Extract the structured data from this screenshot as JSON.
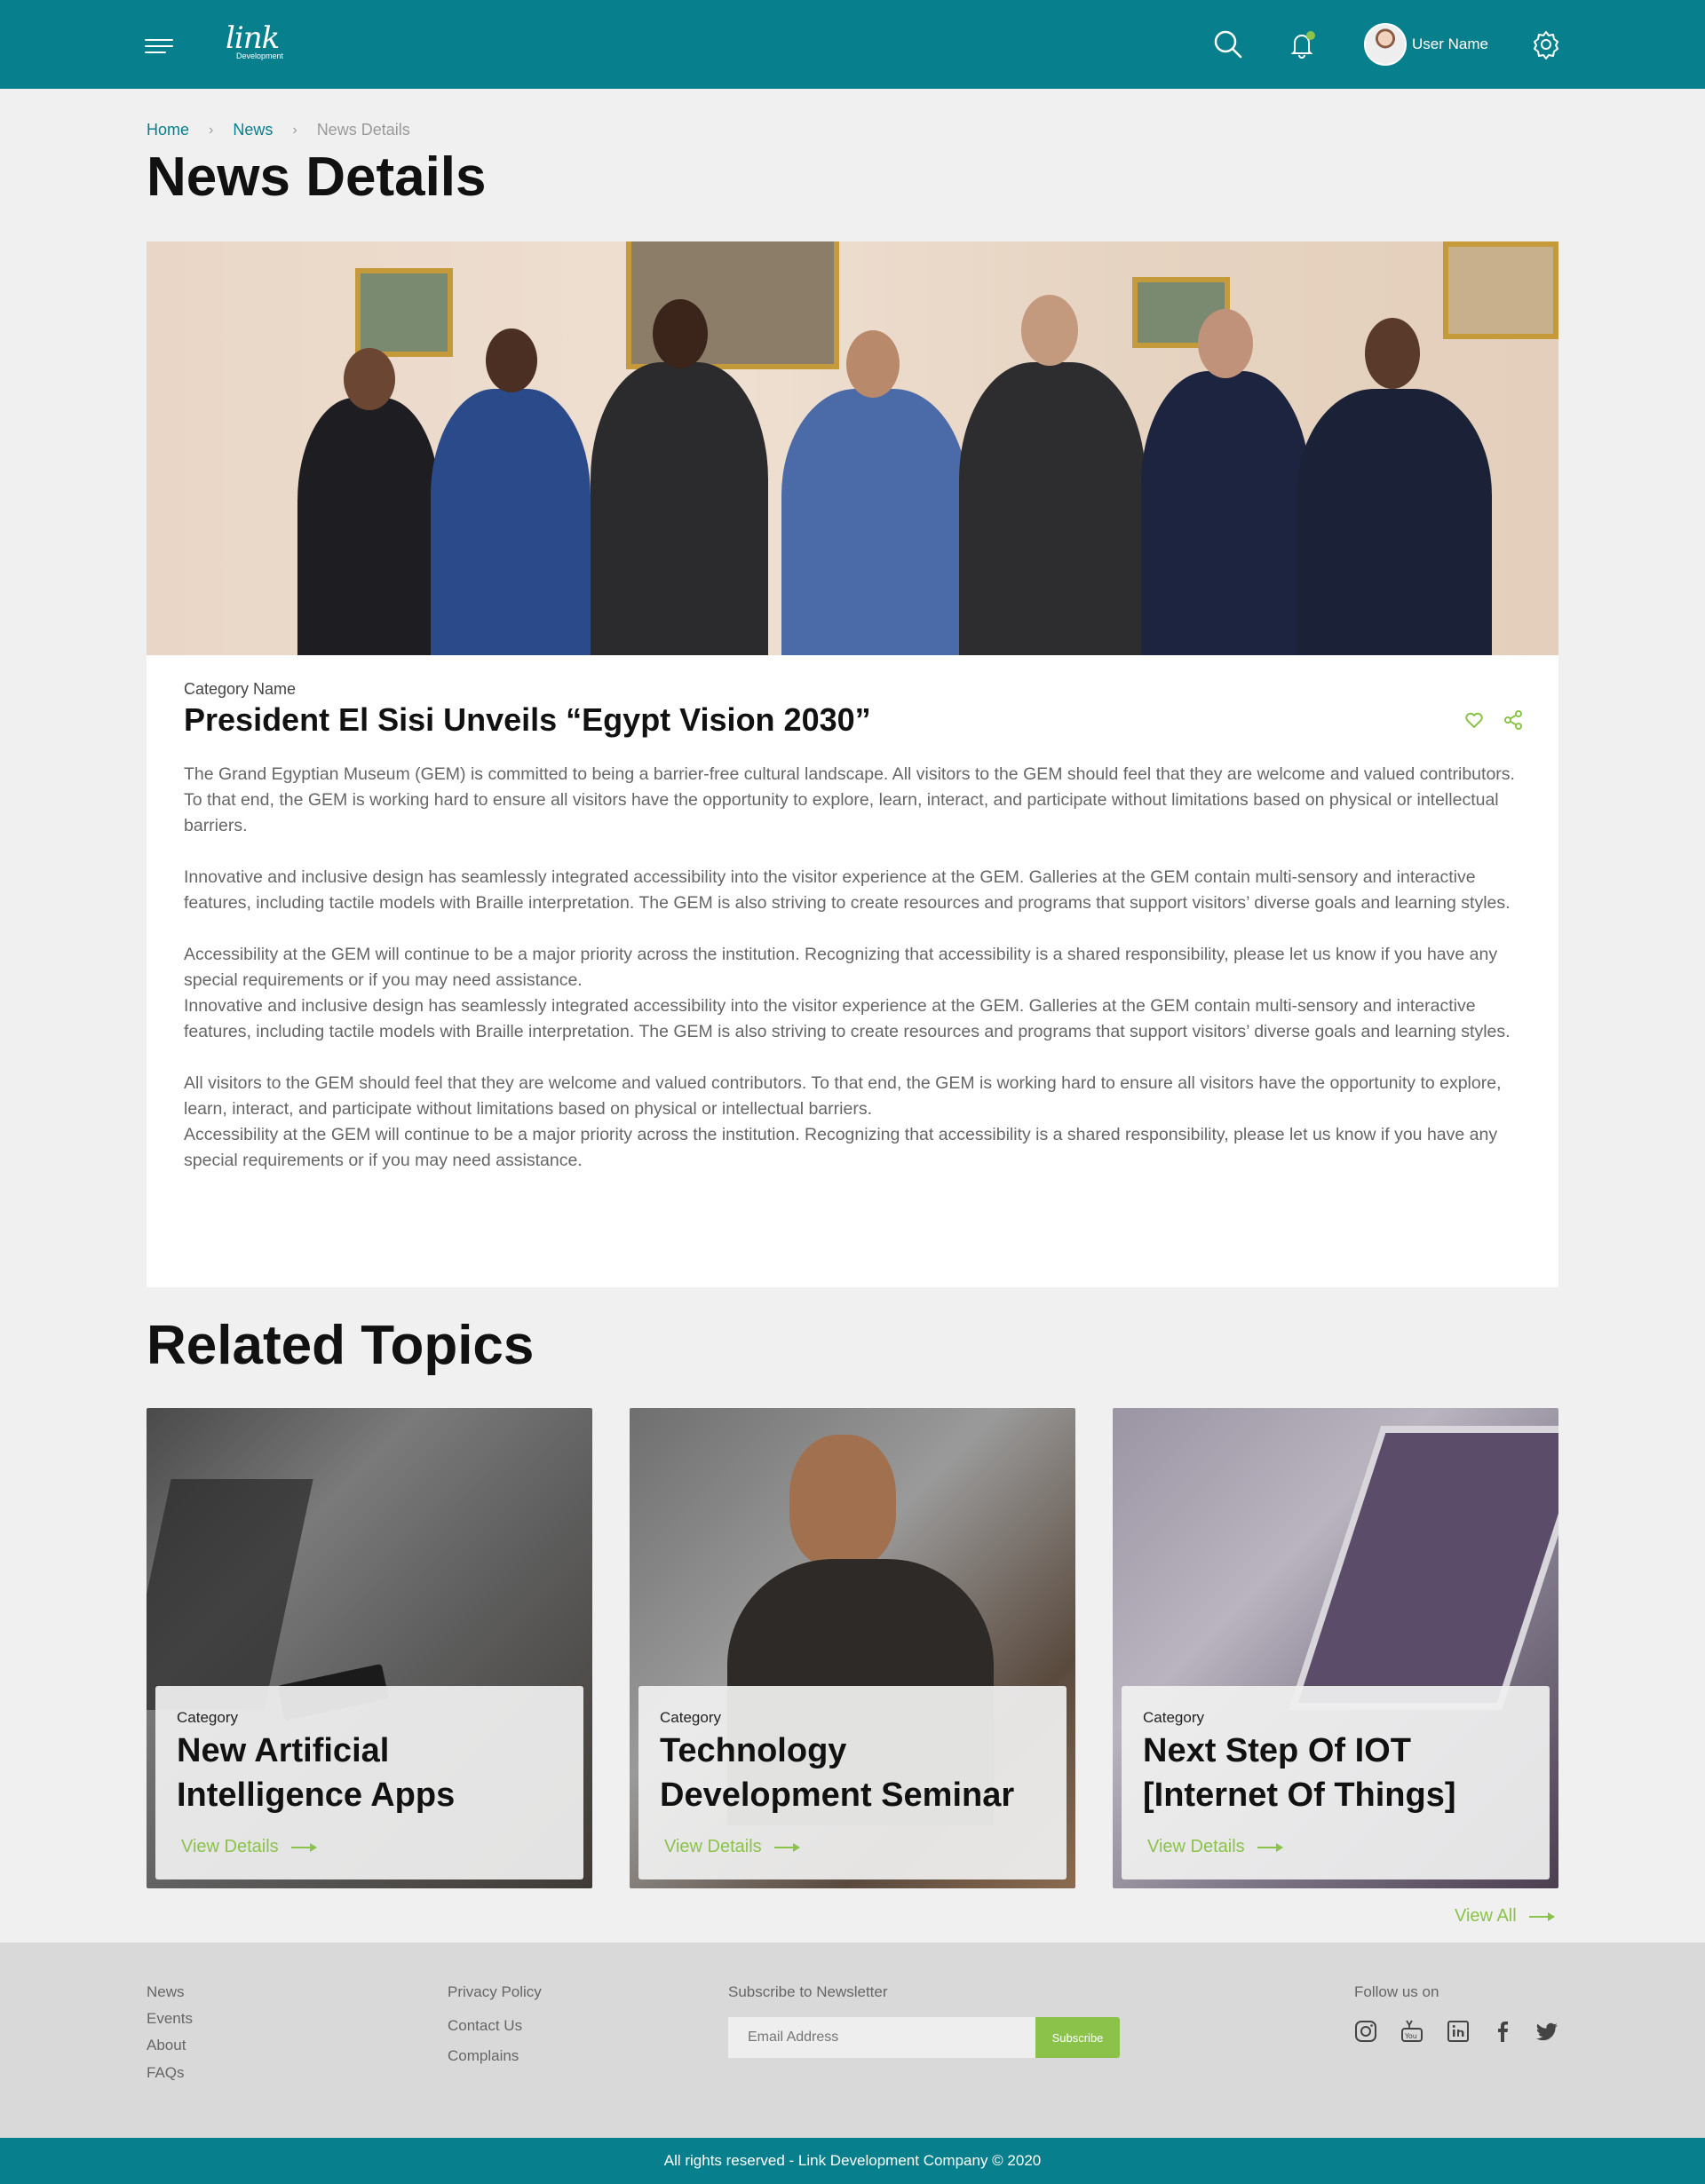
{
  "header": {
    "logo_text": "link",
    "logo_sub": "Development",
    "user_name": "User Name",
    "icons": [
      "menu-icon",
      "search-icon",
      "bell-icon",
      "settings-icon"
    ],
    "accent": "#087f8c"
  },
  "breadcrumb": {
    "items": [
      "Home",
      "News",
      "News Details"
    ],
    "separator": "›"
  },
  "page_title": "News Details",
  "article": {
    "category": "Category Name",
    "title": "President El Sisi Unveils “Egypt Vision 2030”",
    "paragraphs": [
      "The Grand Egyptian Museum (GEM) is committed to being a barrier-free cultural landscape. All visitors to the GEM should feel that they are welcome and valued contributors. To that end, the GEM is working hard to ensure all visitors have the opportunity to explore, learn, interact, and participate without limitations based on physical or intellectual barriers.",
      "Innovative and inclusive design has seamlessly integrated accessibility into the visitor experience at the GEM.  Galleries at the GEM contain multi-sensory and interactive features, including tactile models with Braille interpretation. The GEM is also striving to create resources and programs that support visitors’ diverse goals and learning styles.",
      "Accessibility at the GEM will continue to be a major priority across the institution. Recognizing that accessibility is a shared responsibility, please let us know if you have any special requirements or if you may need assistance.",
      "Innovative and inclusive design has seamlessly integrated accessibility into the visitor experience at the GEM.  Galleries at the GEM contain multi-sensory and interactive features, including tactile models with Braille interpretation. The GEM is also striving to create resources and programs that support visitors’ diverse goals and learning styles.",
      "All visitors to the GEM should feel that they are welcome and valued contributors. To that end, the GEM is working hard to ensure all visitors have the opportunity to explore, learn, interact, and participate without limitations based on physical or intellectual barriers.",
      "Accessibility at the GEM will continue to be a major priority across the institution. Recognizing that accessibility is a shared responsibility, please let us know if you have any special requirements or if you may need assistance."
    ],
    "actions": [
      "heart-icon",
      "share-icon"
    ]
  },
  "related": {
    "title": "Related Topics",
    "cards": [
      {
        "category": "Category",
        "title": "New Artificial Intelligence Apps",
        "link": "View Details"
      },
      {
        "category": "Category",
        "title": "Technology Development Seminar",
        "link": "View Details"
      },
      {
        "category": "Category",
        "title": "Next Step Of IOT [Internet Of Things]",
        "link": "View Details"
      }
    ],
    "view_all": "View All"
  },
  "footer": {
    "col1": [
      "News",
      "Events",
      "About",
      "FAQs"
    ],
    "col2": [
      "Privacy Policy",
      "Contact Us",
      "Complains"
    ],
    "newsletter_label": "Subscribe to Newsletter",
    "email_placeholder": "Email Address",
    "subscribe_label": "Subscribe",
    "follow_label": "Follow us on",
    "social": [
      "instagram-icon",
      "youtube-icon",
      "linkedin-icon",
      "facebook-icon",
      "twitter-icon"
    ],
    "copyright": "All rights reserved - Link Development Company © 2020"
  },
  "colors": {
    "primary": "#087f8c",
    "accent_green": "#8bc34a",
    "background": "#f0f0f0"
  }
}
